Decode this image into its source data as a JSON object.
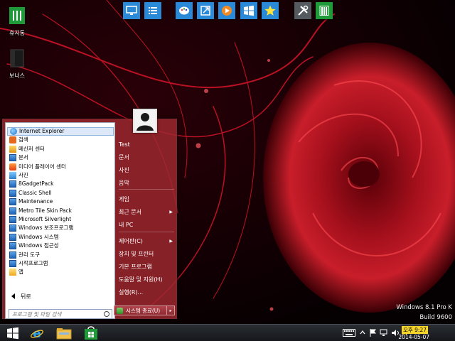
{
  "desktop": {
    "icons": [
      {
        "label": "휴지통"
      },
      {
        "label": "보너스"
      }
    ]
  },
  "launcher": {
    "buttons": [
      {
        "icon": "monitor-icon",
        "color": "#2b8ad8"
      },
      {
        "icon": "list-icon",
        "color": "#2b8ad8"
      },
      {
        "icon": "palette-icon",
        "color": "#2b8ad8"
      },
      {
        "icon": "export-icon",
        "color": "#2b8ad8"
      },
      {
        "icon": "media-player-icon",
        "color": "#2b8ad8"
      },
      {
        "icon": "windows-icon",
        "color": "#2b8ad8"
      },
      {
        "icon": "star-icon",
        "color": "#2b8ad8"
      },
      {
        "icon": "tools-icon",
        "color": "#555a60"
      },
      {
        "icon": "store-icon",
        "color": "#1f9a38"
      }
    ]
  },
  "start_menu": {
    "programs": [
      {
        "label": "Internet Explorer",
        "icon": "ie-icon"
      },
      {
        "label": "검색",
        "icon": "search-app-icon"
      },
      {
        "label": "메신저 센터",
        "icon": "messenger-icon"
      },
      {
        "label": "문서",
        "icon": "folder-icon"
      },
      {
        "label": "미디어 플레이어 센터",
        "icon": "media-center-icon"
      },
      {
        "label": "사진",
        "icon": "photo-icon"
      },
      {
        "label": "8GadgetPack",
        "icon": "folder-icon"
      },
      {
        "label": "Classic Shell",
        "icon": "folder-icon"
      },
      {
        "label": "Maintenance",
        "icon": "folder-icon"
      },
      {
        "label": "Metro Tile Skin Pack",
        "icon": "folder-icon"
      },
      {
        "label": "Microsoft Silverlight",
        "icon": "folder-icon"
      },
      {
        "label": "Windows 보조프로그램",
        "icon": "folder-icon"
      },
      {
        "label": "Windows 시스템",
        "icon": "folder-icon"
      },
      {
        "label": "Windows 접근성",
        "icon": "folder-icon"
      },
      {
        "label": "관리 도구",
        "icon": "folder-icon"
      },
      {
        "label": "시작프로그램",
        "icon": "folder-icon"
      },
      {
        "label": "앱",
        "icon": "apps-icon"
      }
    ],
    "back_label": "뒤로",
    "search_placeholder": "프로그램 및 파일 검색",
    "right_items": [
      {
        "label": "Test",
        "submenu": false
      },
      {
        "label": "문서",
        "submenu": false
      },
      {
        "label": "사진",
        "submenu": false
      },
      {
        "label": "음악",
        "submenu": false
      },
      {
        "label": "게임",
        "submenu": false
      },
      {
        "label": "최근 문서",
        "submenu": true
      },
      {
        "label": "내 PC",
        "submenu": false
      },
      {
        "label": "제어판(C)",
        "submenu": true
      },
      {
        "label": "장치 및 프린터",
        "submenu": false
      },
      {
        "label": "기본 프로그램",
        "submenu": false
      },
      {
        "label": "도움말 및 지원(H)",
        "submenu": false
      },
      {
        "label": "실행(R)...",
        "submenu": false
      }
    ],
    "shutdown_label": "시스템 종료(U)"
  },
  "watermark": {
    "edition": "Windows 8.1 Pro K",
    "build": "Build 9600"
  },
  "taskbar": {
    "pinned": [
      {
        "icon": "start-windows-icon"
      },
      {
        "icon": "internet-explorer-icon"
      },
      {
        "icon": "file-explorer-icon"
      },
      {
        "icon": "store-icon"
      }
    ],
    "clock_time": "오후 9:27",
    "clock_date": "2014-05-07"
  }
}
